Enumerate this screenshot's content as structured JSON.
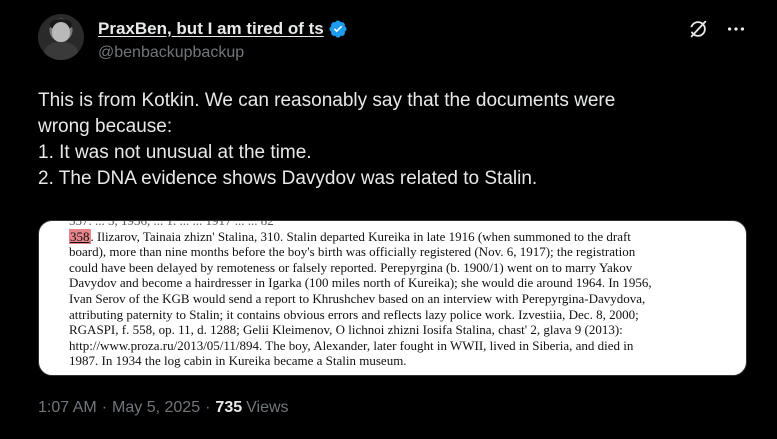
{
  "author": {
    "display_name": "PraxBen, but I am tired of ts",
    "handle": "@benbackupbackup",
    "verified": true
  },
  "icons": {
    "verified": "verified-badge-icon",
    "grok": "grok-icon",
    "more": "more-dots-icon"
  },
  "colors": {
    "verified_blue": "#1d9bf0",
    "highlight": "#e8848c"
  },
  "post": {
    "lines": [
      "This is from Kotkin. We can reasonably say that the documents were",
      "wrong because:",
      "1. It was not unusual at the time.",
      "2. The DNA evidence shows Davydov was related to Stalin."
    ]
  },
  "image": {
    "cut_line": "537. ... 5, 1936, ... 1. ... ... 1917 ... ... 82",
    "note_number": "358",
    "first_line_rest": ". Ilizarov, Tainaia zhizn' Stalina, 310. Stalin departed Kureika in late 1916 (when summoned to the draft",
    "lines": [
      "board), more than nine months before the boy's birth was officially registered (Nov. 6, 1917); the registration",
      "could have been delayed by remoteness or falsely reported. Perepyrgina (b. 1900/1) went on to marry Yakov",
      "Davydov and become a hairdresser in Igarka (100 miles north of Kureika); she would die around 1964. In 1956,",
      "Ivan Serov of the KGB would send a report to Khrushchev based on an interview with Perepyrgina-Davydova,",
      "attributing paternity to Stalin; it contains obvious errors and reflects lazy police work. Izvestiia, Dec. 8, 2000;",
      "RGASPI, f. 558, op. 11, d. 1288; Gelii Kleimenov, O lichnoi zhizni Iosifa Stalina, chast' 2, glava 9 (2013):",
      "http://www.proza.ru/2013/05/11/894. The boy, Alexander, later fought in WWII, lived in Siberia, and died in",
      "1987. In 1934 the log cabin in Kureika became a Stalin museum."
    ]
  },
  "meta": {
    "time": "1:07 AM",
    "date": "May 5, 2025",
    "separator": "·",
    "views_count": "735",
    "views_label": "Views"
  }
}
